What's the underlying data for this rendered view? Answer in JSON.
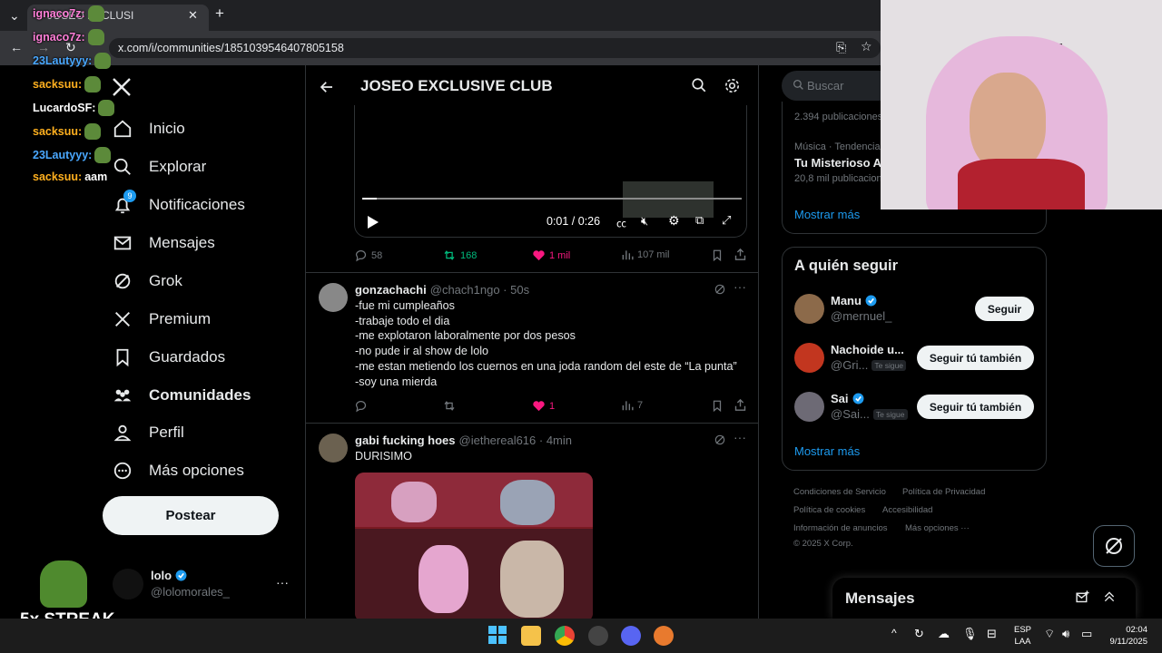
{
  "browser": {
    "tab_title": "JOSEO EXCLUSI",
    "url": "x.com/i/communities/1851039546407805158",
    "new_tab_label": "+"
  },
  "nav": {
    "items": [
      {
        "label": "Inicio",
        "icon": "home-icon",
        "bold": false
      },
      {
        "label": "Explorar",
        "icon": "search-icon",
        "bold": false
      },
      {
        "label": "Notificaciones",
        "icon": "bell-icon",
        "badge": "9",
        "bold": false
      },
      {
        "label": "Mensajes",
        "icon": "mail-icon",
        "bold": false
      },
      {
        "label": "Grok",
        "icon": "grok-icon",
        "bold": false
      },
      {
        "label": "Premium",
        "icon": "x-logo-icon",
        "bold": false
      },
      {
        "label": "Guardados",
        "icon": "bookmark-icon",
        "bold": false
      },
      {
        "label": "Comunidades",
        "icon": "people-icon",
        "bold": true
      },
      {
        "label": "Perfil",
        "icon": "person-icon",
        "bold": false
      },
      {
        "label": "Más opciones",
        "icon": "more-circle-icon",
        "bold": false
      }
    ],
    "post_label": "Postear",
    "account": {
      "name": "lolo",
      "handle": "@lolomorales_",
      "more": "···"
    }
  },
  "feed": {
    "title": "JOSEO EXCLUSIVE CLUB",
    "video": {
      "time": "0:01 / 0:26"
    },
    "video_tweet_metrics": {
      "replies": "58",
      "retweets": "168",
      "likes": "1 mil",
      "views": "107 mil"
    },
    "tweets": [
      {
        "name": "gonzachachi",
        "handle": "@chach1ngo · 50s",
        "lines": [
          "-fue mi cumpleaños",
          "-trabaje todo el dia",
          "-me explotaron laboralmente por dos pesos",
          "-no pude ir al show de lolo",
          "-me estan metiendo los cuernos en una joda random del este de “La punta”",
          "-soy una mierda"
        ],
        "metrics": {
          "replies": "",
          "retweets": "",
          "likes": "1",
          "views": "7"
        }
      },
      {
        "name": "gabi fucking hoes",
        "handle": "@iethereal616 · 4min",
        "lines": [
          "DURISIMO"
        ]
      }
    ]
  },
  "right": {
    "search_placeholder": "Buscar",
    "trends": {
      "first_count": "2.394 publicaciones",
      "trend_category": "Música · Tendencia",
      "trend_title": "Tu Misterioso Al",
      "trend_count": "20,8 mil publicaciones",
      "show_more": "Mostrar más"
    },
    "who_to_follow": {
      "title": "A quién seguir",
      "users": [
        {
          "name": "Manu",
          "handle": "@mernuel_",
          "verified": true,
          "follows_you": "",
          "button": "Seguir"
        },
        {
          "name": "Nachoide u...",
          "handle": "@Gri...",
          "verified": false,
          "follows_you": "Te sigue",
          "button": "Seguir tú también"
        },
        {
          "name": "Sai",
          "handle": "@Sai...",
          "verified": true,
          "follows_you": "Te sigue",
          "button": "Seguir tú también"
        }
      ],
      "show_more": "Mostrar más"
    },
    "footer": {
      "links": [
        "Condiciones de Servicio",
        "Política de Privacidad",
        "Política de cookies",
        "Accesibilidad",
        "Información de anuncios",
        "Más opciones ···"
      ],
      "copyright": "© 2025 X Corp."
    },
    "messages_label": "Mensajes"
  },
  "stream_chat": [
    {
      "user": "ignaco7z:",
      "text": "",
      "color": "#ff7fd8"
    },
    {
      "user": "ignaco7z:",
      "text": "",
      "color": "#ff7fd8"
    },
    {
      "user": "23Lautyyy:",
      "text": "",
      "color": "#4aa8ff"
    },
    {
      "user": "sacksuu:",
      "text": "",
      "color": "#ffb01f"
    },
    {
      "user": "LucardoSF:",
      "text": "",
      "color": "#ffffff"
    },
    {
      "user": "sacksuu:",
      "text": "",
      "color": "#ffb01f"
    },
    {
      "user": "23Lautyyy:",
      "text": "",
      "color": "#4aa8ff"
    },
    {
      "user": "sacksuu:",
      "text": "aam",
      "color": "#ffb01f"
    }
  ],
  "streak": "5x STREAK",
  "taskbar": {
    "language": "ESP",
    "region": "LAA",
    "time": "02:04",
    "date": "9/11/2025"
  },
  "colors": {
    "accent": "#1d9bf0",
    "like": "#f91880",
    "retweet": "#00ba7c"
  }
}
